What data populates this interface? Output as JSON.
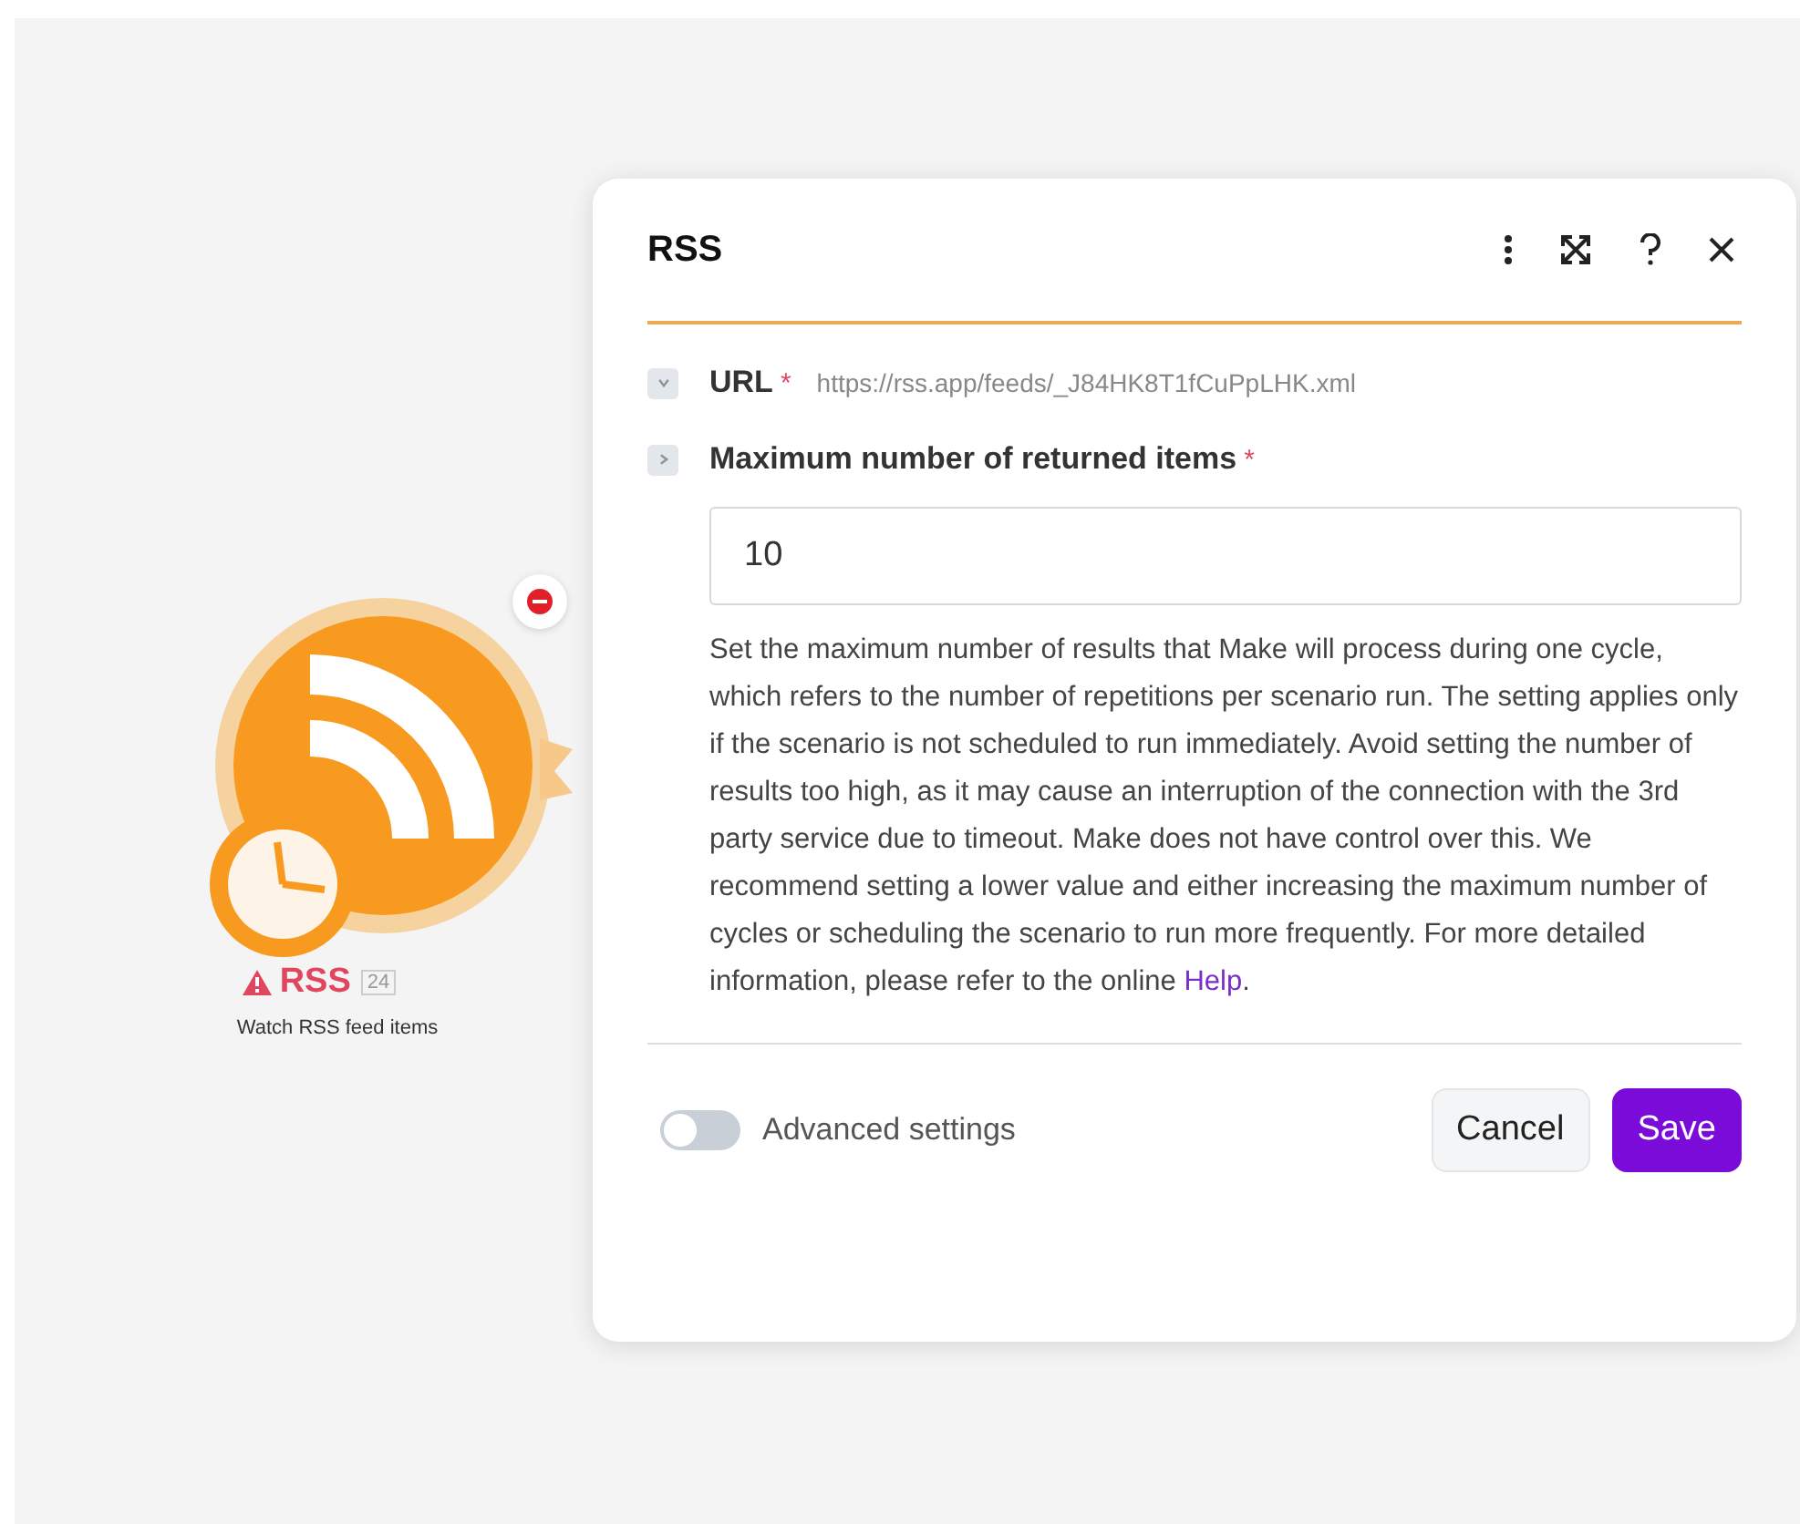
{
  "module": {
    "title": "RSS",
    "warning": true,
    "count": "24",
    "subtitle": "Watch RSS feed items"
  },
  "dialog": {
    "title": "RSS",
    "fields": [
      {
        "kind": "inline",
        "label": "URL",
        "required_mark": "*",
        "expanded": true,
        "value": "https://rss.app/feeds/_J84HK8T1fCuPpLHK.xml"
      },
      {
        "kind": "input",
        "label": "Maximum number of returned items",
        "required_mark": "*",
        "expanded": false,
        "value": "10",
        "help": "Set the maximum number of results that Make will process during one cycle, which refers to the number of repetitions per scenario run. The setting applies only if the scenario is not scheduled to run immediately. Avoid setting the number of results too high, as it may cause an interruption of the connection with the 3rd party service due to timeout. Make does not have control over this. We recommend setting a lower value and either increasing the maximum number of cycles or scheduling the scenario to run more frequently. For more detailed information, please refer to the online",
        "help_link": "Help",
        "help_end": "."
      }
    ],
    "advanced": {
      "label": "Advanced settings",
      "on": false
    },
    "buttons": [
      {
        "kind": "secondary",
        "label": "Cancel"
      },
      {
        "kind": "primary",
        "label": "Save"
      }
    ]
  }
}
